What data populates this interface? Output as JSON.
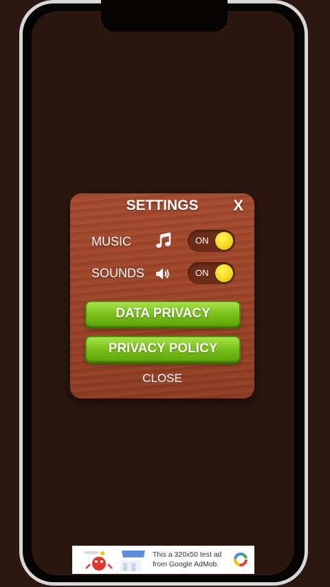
{
  "settings": {
    "title": "SETTINGS",
    "close_icon": "X",
    "rows": [
      {
        "label": "MUSIC",
        "icon": "music-note-icon",
        "toggle_state": "ON"
      },
      {
        "label": "SOUNDS",
        "icon": "speaker-icon",
        "toggle_state": "ON"
      }
    ],
    "buttons": {
      "data_privacy": "DATA PRIVACY",
      "privacy_policy": "PRIVACY POLICY"
    },
    "close_label": "CLOSE"
  },
  "ad": {
    "line1": "This a 320x50 test ad",
    "line2": "from Google AdMob."
  },
  "colors": {
    "background": "#2a170f",
    "panel": "#9c4328",
    "toggle_bg": "#6c2d18",
    "knob": "#f5d61a",
    "button_green": "#7cc21c"
  }
}
